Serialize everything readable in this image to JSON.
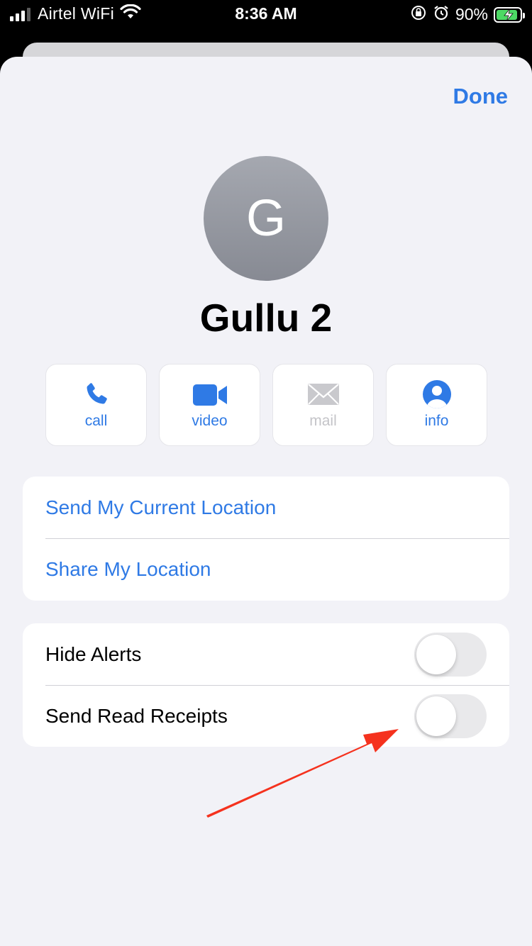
{
  "status_bar": {
    "carrier": "Airtel WiFi",
    "time": "8:36 AM",
    "battery_percent": "90%",
    "battery_level": 0.9,
    "icons": [
      "signal-icon",
      "wifi-icon",
      "orientation-lock-icon",
      "alarm-icon",
      "battery-charging-icon"
    ]
  },
  "header": {
    "done_label": "Done"
  },
  "contact": {
    "initial": "G",
    "name": "Gullu 2"
  },
  "actions": [
    {
      "label": "call",
      "icon": "phone-icon",
      "enabled": true
    },
    {
      "label": "video",
      "icon": "video-camera-icon",
      "enabled": true
    },
    {
      "label": "mail",
      "icon": "envelope-icon",
      "enabled": false
    },
    {
      "label": "info",
      "icon": "person-icon",
      "enabled": true
    }
  ],
  "location_group": {
    "send_current_location": "Send My Current Location",
    "share_location": "Share My Location"
  },
  "settings_group": {
    "hide_alerts": {
      "label": "Hide Alerts",
      "on": false
    },
    "send_read_receipts": {
      "label": "Send Read Receipts",
      "on": false
    }
  },
  "colors": {
    "accent": "#2f7ae5",
    "background": "#f2f2f7",
    "annotation_arrow": "#f5321e"
  }
}
